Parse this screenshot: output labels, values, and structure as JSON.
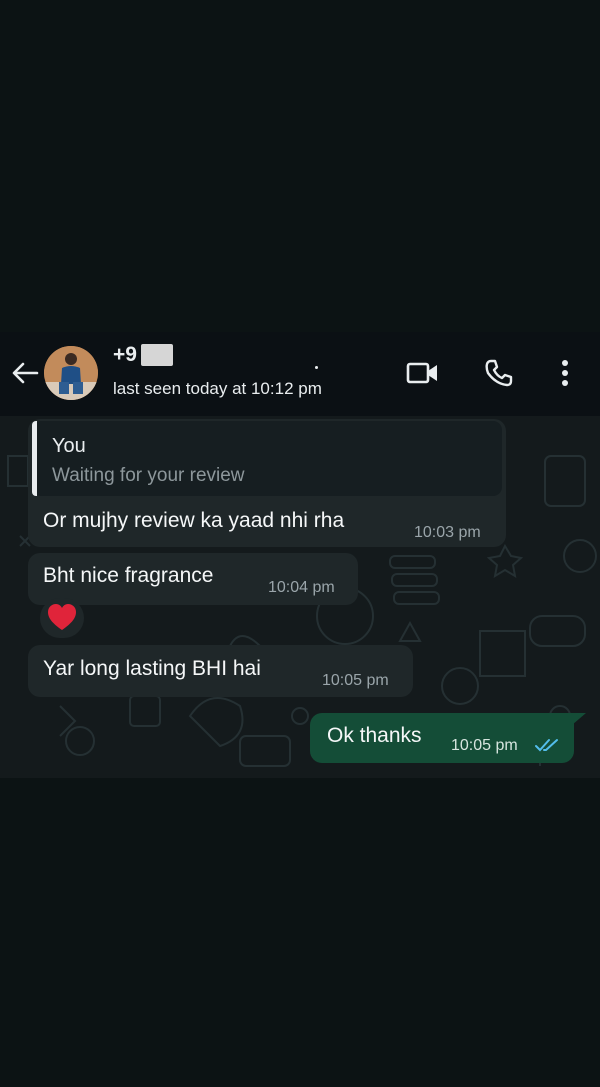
{
  "header": {
    "contact_name": "+9",
    "status": "last seen today at 10:12 pm"
  },
  "messages": [
    {
      "direction": "incoming",
      "quote": {
        "author": "You",
        "text": "Waiting for your review"
      },
      "text": "Or mujhy review ka yaad nhi rha",
      "time": "10:03 pm"
    },
    {
      "direction": "incoming",
      "text": "Bht nice fragrance",
      "time": "10:04 pm",
      "reaction": "heart"
    },
    {
      "direction": "incoming",
      "text": "Yar long lasting BHI hai",
      "time": "10:05 pm"
    },
    {
      "direction": "outgoing",
      "text": "Ok thanks",
      "time": "10:05 pm",
      "status": "read"
    }
  ],
  "icons": [
    "back-arrow-icon",
    "video-call-icon",
    "phone-icon",
    "more-options-icon",
    "double-check-icon",
    "heart-icon"
  ],
  "colors": {
    "incoming_bubble": "#1f2729",
    "outgoing_bubble": "#144d37",
    "read_ticks": "#53bdeb",
    "background": "#0c1314"
  }
}
